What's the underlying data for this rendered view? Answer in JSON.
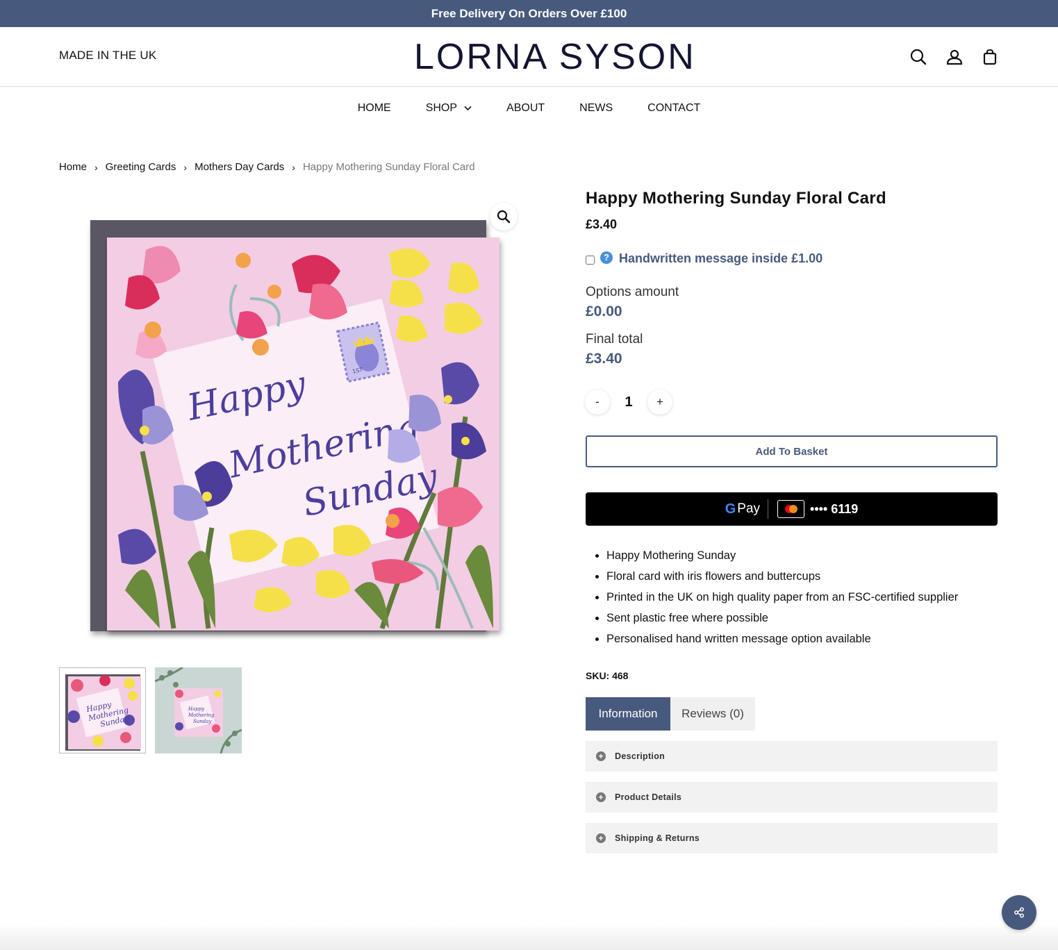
{
  "topbar": {
    "text": "Free Delivery On Orders Over £100"
  },
  "header": {
    "tagline": "MADE IN THE UK",
    "logo": "LORNA SYSON",
    "icons": [
      "search-icon",
      "account-icon",
      "bag-icon"
    ]
  },
  "nav": {
    "items": [
      {
        "label": "HOME"
      },
      {
        "label": "SHOP"
      },
      {
        "label": "ABOUT"
      },
      {
        "label": "NEWS"
      },
      {
        "label": "CONTACT"
      }
    ]
  },
  "breadcrumb": [
    "Home",
    "Greeting Cards",
    "Mothers Day Cards",
    "Happy Mothering Sunday Floral Card"
  ],
  "gallery": {
    "card_text": [
      "Happy",
      "Mothering",
      "Sunday"
    ],
    "stamp_text": "1ST"
  },
  "product": {
    "title": "Happy Mothering Sunday Floral Card",
    "price": "£3.40",
    "option_label": "Handwritten message inside £1.00",
    "option_help": "?",
    "options_amount_label": "Options amount",
    "options_amount_value": "£0.00",
    "final_total_label": "Final total",
    "final_total_value": "£3.40",
    "qty_minus": "-",
    "quantity": "1",
    "qty_plus": "+",
    "add_to_basket": "Add To Basket",
    "gpay": {
      "g": "G",
      "pay": "Pay",
      "card_number": "•••• 6119"
    },
    "bullets": [
      "Happy Mothering Sunday",
      "Floral card with iris flowers and buttercups",
      "Printed in the UK on high quality paper from an FSC-certified supplier",
      "Sent plastic free where possible",
      "Personalised hand written message option available"
    ],
    "sku": "SKU: 468"
  },
  "tabs": [
    {
      "label": "Information",
      "active": true
    },
    {
      "label": "Reviews (0)",
      "active": false
    }
  ],
  "accordion": [
    "Description",
    "Product Details",
    "Shipping & Returns"
  ],
  "colors": {
    "brand": "#475a7e",
    "card_pink": "#f2cde4",
    "iris": "#5a4aa8",
    "buttercup": "#f5e04a",
    "poppy": "#e5446e"
  }
}
